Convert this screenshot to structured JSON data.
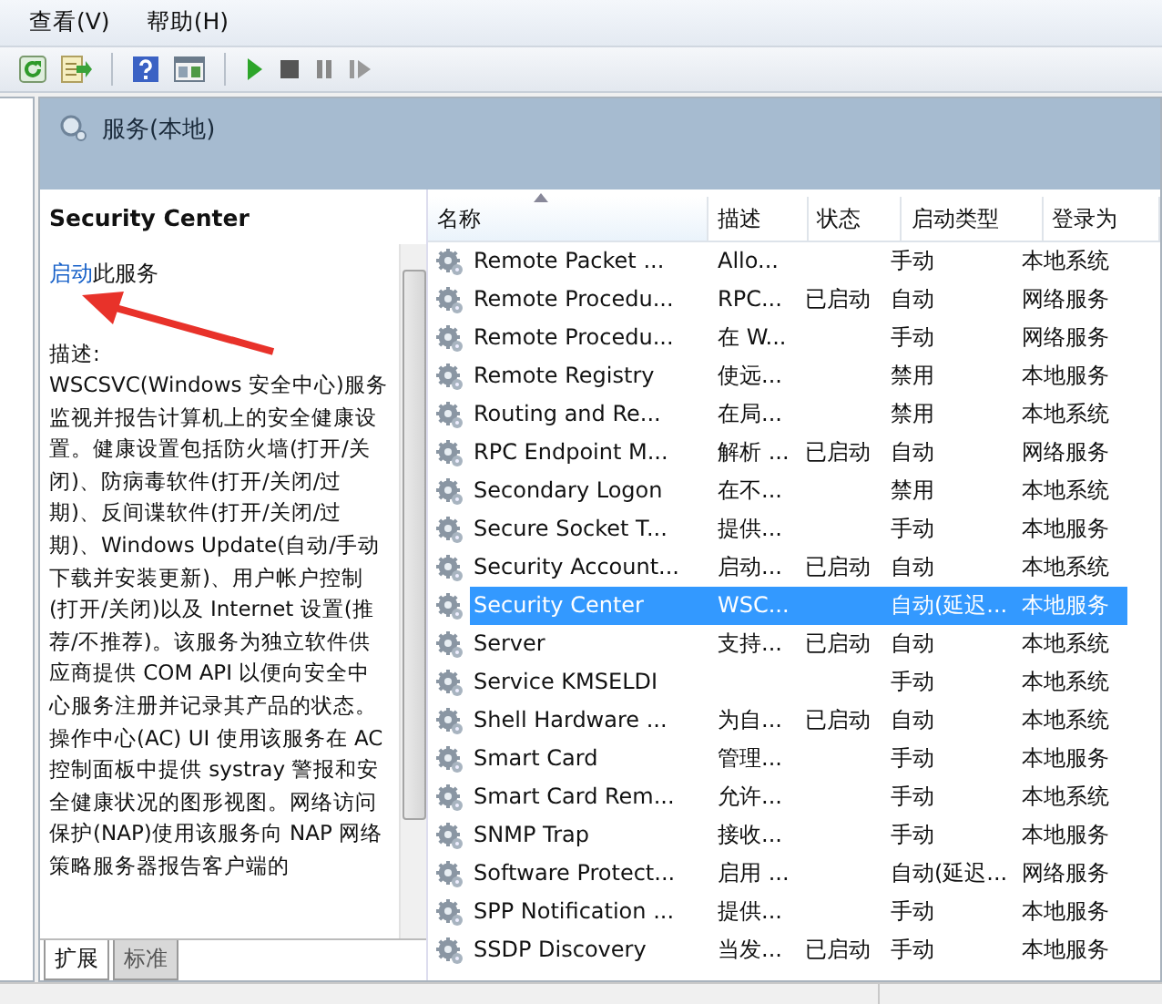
{
  "menu": [
    {
      "label": "查看(V)"
    },
    {
      "label": "帮助(H)"
    }
  ],
  "pane_title": "服务(本地)",
  "details": {
    "title": "Security Center",
    "action_link": "启动",
    "action_text": "此服务",
    "description_label": "描述:",
    "description": "WSCSVC(Windows 安全中心)服务监视并报告计算机上的安全健康设置。健康设置包括防火墙(打开/关闭)、防病毒软件(打开/关闭/过期)、反间谍软件(打开/关闭/过期)、Windows Update(自动/手动下载并安装更新)、用户帐户控制(打开/关闭)以及 Internet 设置(推荐/不推荐)。该服务为独立软件供应商提供 COM API 以便向安全中心服务注册并记录其产品的状态。操作中心(AC) UI 使用该服务在 AC 控制面板中提供 systray 警报和安全健康状况的图形视图。网络访问保护(NAP)使用该服务向 NAP 网络策略服务器报告客户端的"
  },
  "columns": [
    "名称",
    "描述",
    "状态",
    "启动类型",
    "登录为"
  ],
  "rows": [
    {
      "name": "Remote Packet ...",
      "description": "Allo...",
      "status": "",
      "startup": "手动",
      "logon": "本地系统",
      "selected": false
    },
    {
      "name": "Remote Procedu...",
      "description": "RPC...",
      "status": "已启动",
      "startup": "自动",
      "logon": "网络服务",
      "selected": false
    },
    {
      "name": "Remote Procedu...",
      "description": "在 W...",
      "status": "",
      "startup": "手动",
      "logon": "网络服务",
      "selected": false
    },
    {
      "name": "Remote Registry",
      "description": "使远...",
      "status": "",
      "startup": "禁用",
      "logon": "本地服务",
      "selected": false
    },
    {
      "name": "Routing and Re...",
      "description": "在局...",
      "status": "",
      "startup": "禁用",
      "logon": "本地系统",
      "selected": false
    },
    {
      "name": "RPC Endpoint M...",
      "description": "解析 ...",
      "status": "已启动",
      "startup": "自动",
      "logon": "网络服务",
      "selected": false
    },
    {
      "name": "Secondary Logon",
      "description": "在不...",
      "status": "",
      "startup": "禁用",
      "logon": "本地系统",
      "selected": false
    },
    {
      "name": "Secure Socket T...",
      "description": "提供...",
      "status": "",
      "startup": "手动",
      "logon": "本地服务",
      "selected": false
    },
    {
      "name": "Security Account...",
      "description": "启动...",
      "status": "已启动",
      "startup": "自动",
      "logon": "本地系统",
      "selected": false
    },
    {
      "name": "Security Center",
      "description": "WSC...",
      "status": "",
      "startup": "自动(延迟...",
      "logon": "本地服务",
      "selected": true
    },
    {
      "name": "Server",
      "description": "支持...",
      "status": "已启动",
      "startup": "自动",
      "logon": "本地系统",
      "selected": false
    },
    {
      "name": "Service KMSELDI",
      "description": "",
      "status": "",
      "startup": "手动",
      "logon": "本地系统",
      "selected": false
    },
    {
      "name": "Shell Hardware ...",
      "description": "为自...",
      "status": "已启动",
      "startup": "自动",
      "logon": "本地系统",
      "selected": false
    },
    {
      "name": "Smart Card",
      "description": "管理...",
      "status": "",
      "startup": "手动",
      "logon": "本地服务",
      "selected": false
    },
    {
      "name": "Smart Card Rem...",
      "description": "允许...",
      "status": "",
      "startup": "手动",
      "logon": "本地系统",
      "selected": false
    },
    {
      "name": "SNMP Trap",
      "description": "接收...",
      "status": "",
      "startup": "手动",
      "logon": "本地服务",
      "selected": false
    },
    {
      "name": "Software Protect...",
      "description": "启用 ...",
      "status": "",
      "startup": "自动(延迟...",
      "logon": "网络服务",
      "selected": false
    },
    {
      "name": "SPP Notification ...",
      "description": "提供...",
      "status": "",
      "startup": "手动",
      "logon": "本地服务",
      "selected": false
    },
    {
      "name": "SSDP Discovery",
      "description": "当发...",
      "status": "已启动",
      "startup": "手动",
      "logon": "本地服务",
      "selected": false
    }
  ],
  "view_tabs": [
    {
      "label": "扩展",
      "selected": true
    },
    {
      "label": "标准",
      "selected": false
    }
  ]
}
